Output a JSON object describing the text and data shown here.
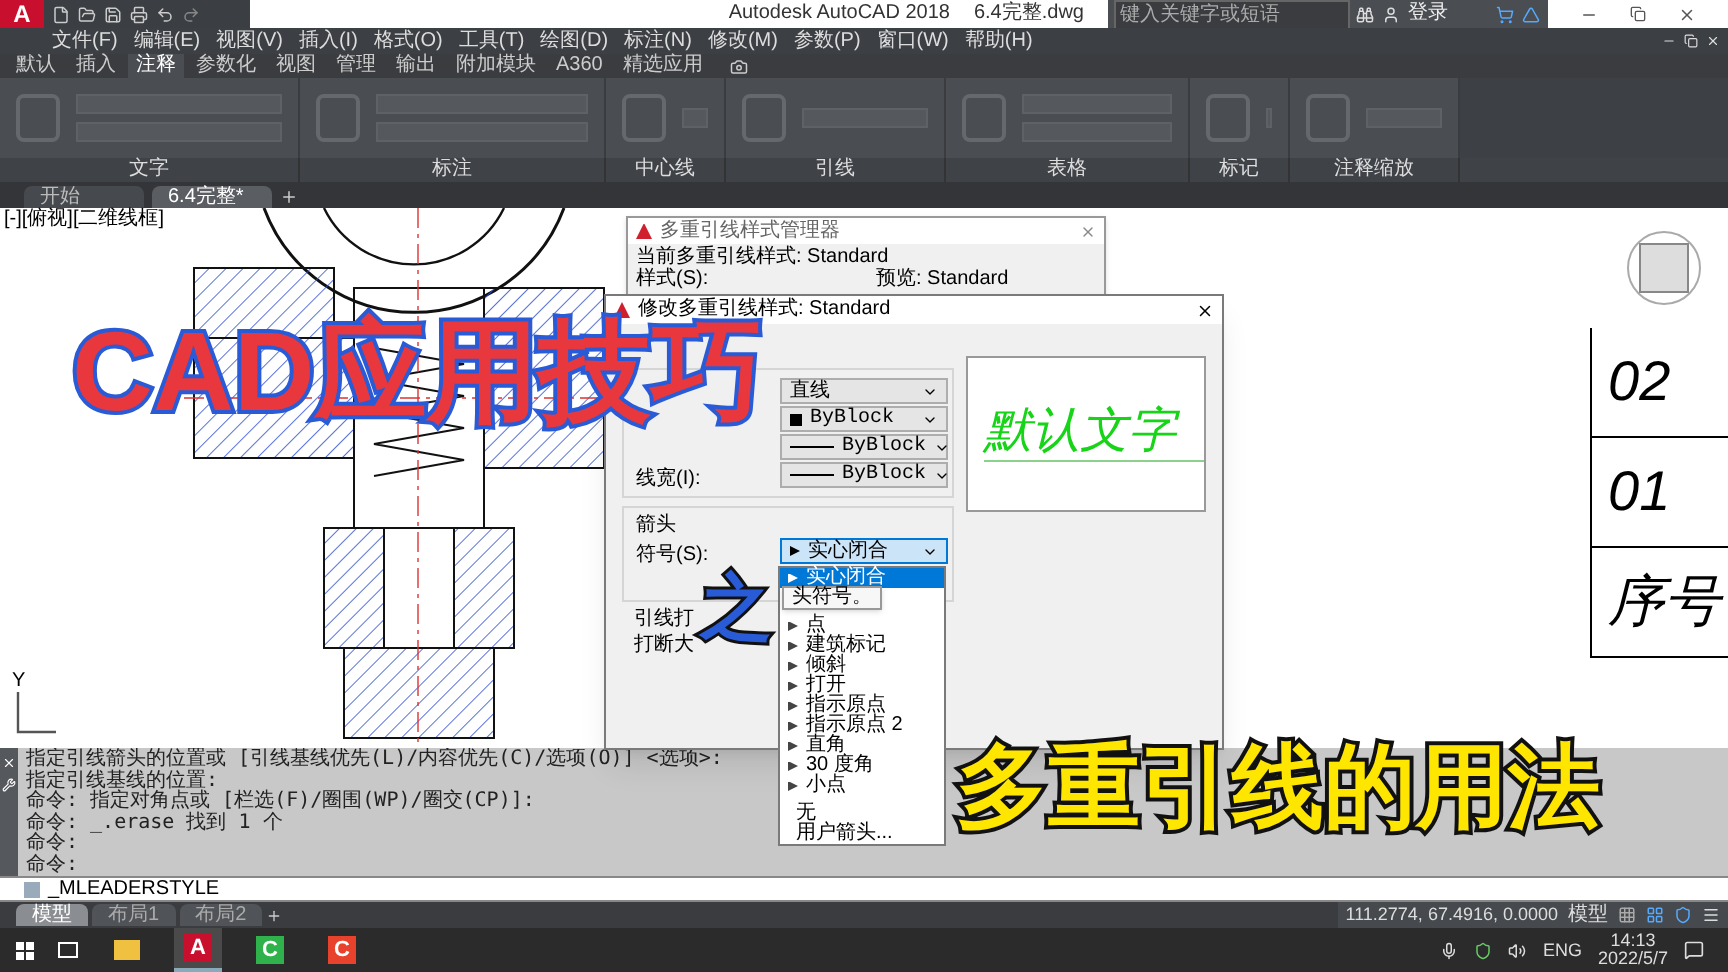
{
  "title_bar": {
    "app_logo": "A",
    "title": "Autodesk AutoCAD 2018",
    "file_name": "6.4完整.dwg",
    "search_placeholder": "键入关键字或短语",
    "sign_in": "登录"
  },
  "menu_bar": [
    "文件(F)",
    "编辑(E)",
    "视图(V)",
    "插入(I)",
    "格式(O)",
    "工具(T)",
    "绘图(D)",
    "标注(N)",
    "修改(M)",
    "参数(P)",
    "窗口(W)",
    "帮助(H)"
  ],
  "ribbon_tabs": [
    {
      "label": "默认",
      "selected": false
    },
    {
      "label": "插入",
      "selected": false
    },
    {
      "label": "注释",
      "selected": true
    },
    {
      "label": "参数化",
      "selected": false
    },
    {
      "label": "视图",
      "selected": false
    },
    {
      "label": "管理",
      "selected": false
    },
    {
      "label": "输出",
      "selected": false
    },
    {
      "label": "附加模块",
      "selected": false
    },
    {
      "label": "A360",
      "selected": false
    },
    {
      "label": "精选应用",
      "selected": false
    }
  ],
  "ribbon_panels": [
    "文字",
    "标注",
    "中心线",
    "引线",
    "表格",
    "标记",
    "注释缩放"
  ],
  "file_tabs": [
    {
      "label": "开始",
      "selected": false
    },
    {
      "label": "6.4完整*",
      "selected": true
    }
  ],
  "viewport_label": "[-][俯视][二维线框]",
  "ucs_axis_label": "Y",
  "title_block": [
    "02",
    "01",
    "序号"
  ],
  "leader_style_manager": {
    "title": "多重引线样式管理器",
    "current_style": "当前多重引线样式: Standard",
    "styles_label": "样式(S):",
    "preview_label": "预览: Standard"
  },
  "modify_dialog": {
    "title": "修改多重引线样式: Standard",
    "leader_format": [
      {
        "kind": "plain",
        "value": "直线"
      },
      {
        "kind": "swatch",
        "value": "ByBlock"
      },
      {
        "kind": "line",
        "value": "ByBlock"
      },
      {
        "kind": "line",
        "label": "线宽(I):",
        "value": "ByBlock"
      }
    ],
    "arrowhead_heading": "箭头",
    "symbol_label": "符号(S):",
    "symbol_value": "实心闭合",
    "leader_break_label": "引线打",
    "break_size_label": "打断大",
    "arrow_options": [
      {
        "label": "实心闭合",
        "selected": true
      },
      {
        "label": "点",
        "selected": false
      },
      {
        "label": "建筑标记",
        "selected": false
      },
      {
        "label": "倾斜",
        "selected": false
      },
      {
        "label": "打开",
        "selected": false
      },
      {
        "label": "指示原点",
        "selected": false
      },
      {
        "label": "指示原点 2",
        "selected": false
      },
      {
        "label": "直角",
        "selected": false
      },
      {
        "label": "30 度角",
        "selected": false
      },
      {
        "label": "小点",
        "selected": false
      }
    ],
    "arrow_options_end": [
      {
        "label": "无",
        "selected": false
      },
      {
        "label": "用户箭头...",
        "selected": false
      }
    ],
    "tooltip": "头符号。",
    "preview_text": "默认文字"
  },
  "video_title": {
    "line_1": "CAD应用技巧",
    "connector": "之",
    "line_2": "多重引线的用法"
  },
  "command_history": [
    "指定引线箭头的位置或 [引线基线优先(L)/内容优先(C)/选项(O)] <选项>:",
    "指定引线基线的位置:",
    "命令: 指定对角点或 [栏选(F)/圈围(WP)/圈交(CP)]:",
    "命令: _.erase 找到 1 个",
    "命令:",
    "命令:"
  ],
  "command_input": "_MLEADERSTYLE",
  "layout_tabs": [
    {
      "label": "模型",
      "selected": true
    },
    {
      "label": "布局1",
      "selected": false
    },
    {
      "label": "布局2",
      "selected": false
    }
  ],
  "status_bar": {
    "coordinates": "111.2774, 67.4916, 0.0000",
    "space": "模型"
  },
  "taskbar": {
    "apps": [
      {
        "kind": "folder",
        "selected": false
      },
      {
        "kind": "letter",
        "label": "A",
        "color": "#c8102e",
        "selected": true
      },
      {
        "kind": "letter",
        "label": "C",
        "color": "#2fb24c",
        "selected": false
      },
      {
        "kind": "letter",
        "label": "C",
        "color": "#e8412c",
        "selected": false
      }
    ],
    "language": "ENG",
    "time": "14:13",
    "date": "2022/5/7"
  }
}
